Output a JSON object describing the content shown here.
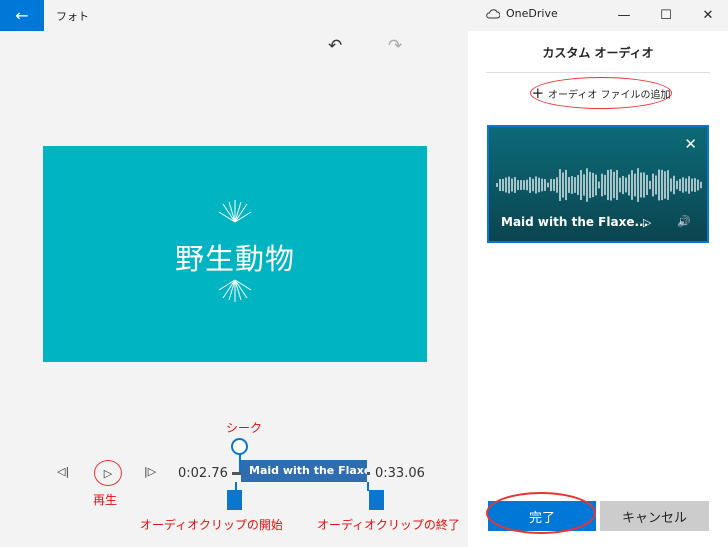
{
  "window": {
    "title": "フォト",
    "onedrive_label": "OneDrive",
    "back": "←",
    "minimize": "—",
    "maximize": "☐",
    "close": "✕"
  },
  "toolbar": {
    "undo": "↶",
    "redo": "↷"
  },
  "preview": {
    "title": "野生動物"
  },
  "timeline": {
    "prev_frame": "◁|",
    "play": "▷",
    "next_frame": "|▷",
    "start_time": "0:02.76",
    "end_time": "0:33.06",
    "clip_label": "Maid with the Flaxen"
  },
  "annotations": {
    "seek": "シーク",
    "play": "再生",
    "clip_start": "オーディオクリップの開始",
    "clip_end": "オーディオクリップの終了"
  },
  "panel": {
    "title": "カスタム オーディオ",
    "add_audio": "オーディオ ファイルの追加",
    "add_icon": "+",
    "card_name": "Maid with the Flaxe...",
    "card_close": "✕",
    "card_play": "▷",
    "card_volume": "🔊",
    "done": "完了",
    "cancel": "キャンセル"
  },
  "colors": {
    "accent": "#0078d7",
    "annotation": "#e01010",
    "preview_bg": "#00b4c1"
  }
}
